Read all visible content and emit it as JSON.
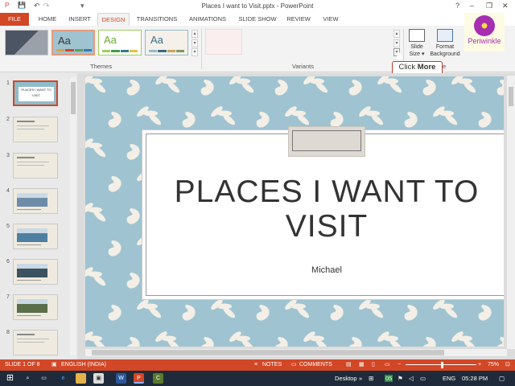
{
  "window": {
    "title": "Places I want to Visit.pptx - PowerPoint",
    "help_icon": "?",
    "minimize_icon": "–",
    "restore_icon": "❐",
    "close_icon": "✕"
  },
  "quick_access": {
    "save_icon": "💾",
    "undo_icon": "↶",
    "redo_icon": "↷",
    "customize_icon": "▾"
  },
  "tabs": [
    "FILE",
    "HOME",
    "INSERT",
    "DESIGN",
    "TRANSITIONS",
    "ANIMATIONS",
    "SLIDE SHOW",
    "REVIEW",
    "VIEW"
  ],
  "active_tab": "DESIGN",
  "ribbon": {
    "themes_label": "Themes",
    "variants_label": "Variants",
    "theme_aa": "Aa",
    "slide_size_label": "Slide\nSize ▾",
    "format_background_label": "Format\nBackground",
    "customize_group_fragment": "e"
  },
  "logo": {
    "text": "Periwinkle"
  },
  "callout": {
    "prefix": "Click ",
    "emphasis": "More"
  },
  "slides": [
    {
      "num": "1",
      "kind": "title",
      "text": "PLACES I WANT TO VISIT"
    },
    {
      "num": "2",
      "kind": "text"
    },
    {
      "num": "3",
      "kind": "text"
    },
    {
      "num": "4",
      "kind": "picture",
      "color": "#6e8ca8"
    },
    {
      "num": "5",
      "kind": "picture",
      "color": "#4f7fa0"
    },
    {
      "num": "6",
      "kind": "picture",
      "color": "#3d5260"
    },
    {
      "num": "7",
      "kind": "picture",
      "color": "#5a6e4a"
    },
    {
      "num": "8",
      "kind": "text"
    }
  ],
  "slide": {
    "title": "PLACES I WANT TO VISIT",
    "subtitle": "Michael"
  },
  "status": {
    "slide_of": "SLIDE 1 OF 8",
    "language": "ENGLISH (INDIA)",
    "notes": "NOTES",
    "comments": "COMMENTS",
    "zoom": "75%"
  },
  "taskbar": {
    "desktop": "Desktop",
    "language": "ENG",
    "time": "05:28 PM"
  },
  "colors": {
    "accent": "#d24726",
    "slide_bg": "#9fc3d1",
    "leaf": "#f3efe6"
  }
}
